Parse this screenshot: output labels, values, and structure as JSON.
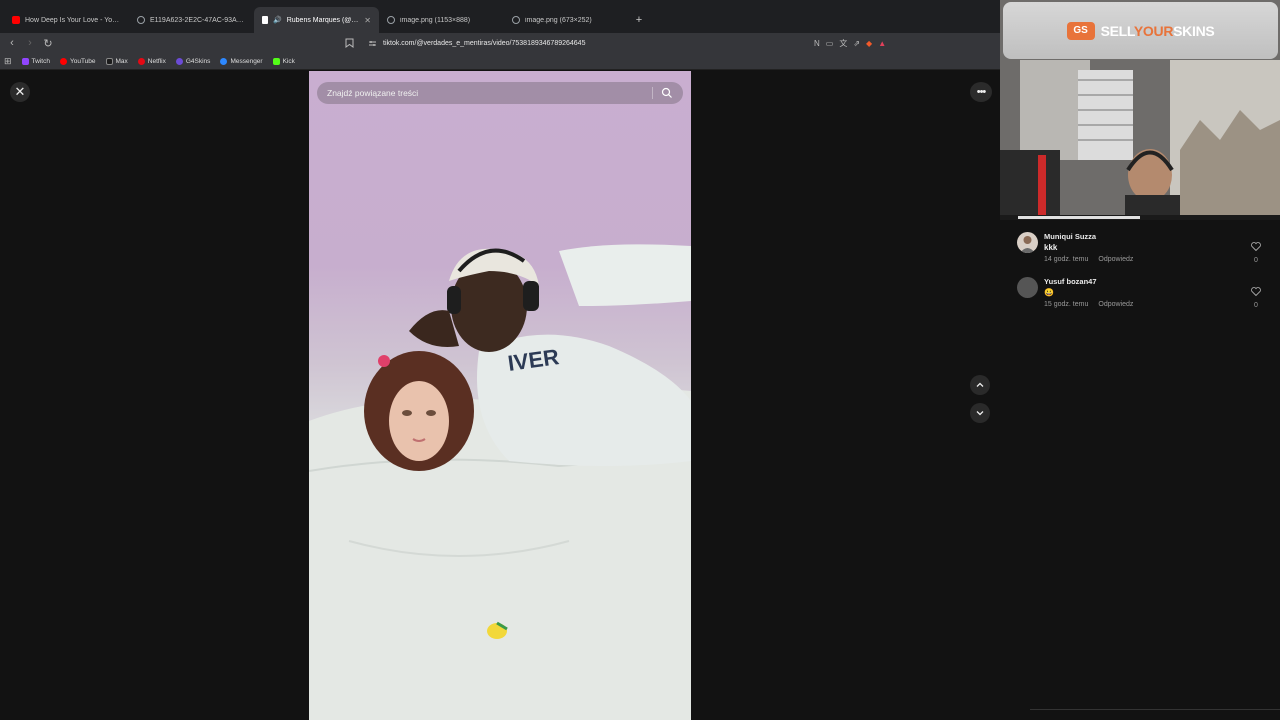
{
  "browser": {
    "tabs": [
      {
        "title": "How Deep Is Your Love - YouTube",
        "favicon_color": "#ff0000",
        "active": false
      },
      {
        "title": "E119A623-2E2C-47AC-93AD-0239B...",
        "favicon_color": "#9aa0a6",
        "active": false
      },
      {
        "title": "Rubens Marques (@verdades_...",
        "favicon_color": "#ffffff",
        "active": true
      },
      {
        "title": "image.png (1153×888)",
        "favicon_color": "#9aa0a6",
        "active": false
      },
      {
        "title": "image.png (673×252)",
        "favicon_color": "#9aa0a6",
        "active": false
      }
    ],
    "url": "tiktok.com/@verdades_e_mentiras/video/7538189346789264645",
    "bookmarks": [
      {
        "label": "Twitch",
        "color": "#9146ff"
      },
      {
        "label": "YouTube",
        "color": "#ff0000"
      },
      {
        "label": "Max",
        "color": "#2a2aff"
      },
      {
        "label": "Netflix",
        "color": "#e50914"
      },
      {
        "label": "G4Skins",
        "color": "#6b4bd6"
      },
      {
        "label": "Messenger",
        "color": "#2d88ff"
      },
      {
        "label": "Kick",
        "color": "#53fc18"
      }
    ]
  },
  "player": {
    "search_placeholder": "Znajdź powiązane treści"
  },
  "sponsor": {
    "logo_text": "GS",
    "name_part1": "SELL",
    "name_part2": "YOUR",
    "name_part3": "SKINS"
  },
  "comments": [
    {
      "user": "Muniqui Suzza",
      "text": "kkk",
      "time": "14 godz. temu",
      "reply": "Odpowiedz",
      "likes": "0"
    },
    {
      "user": "Yusuf bozan47",
      "text": "😀",
      "time": "15 godz. temu",
      "reply": "Odpowiedz",
      "likes": "0"
    }
  ]
}
